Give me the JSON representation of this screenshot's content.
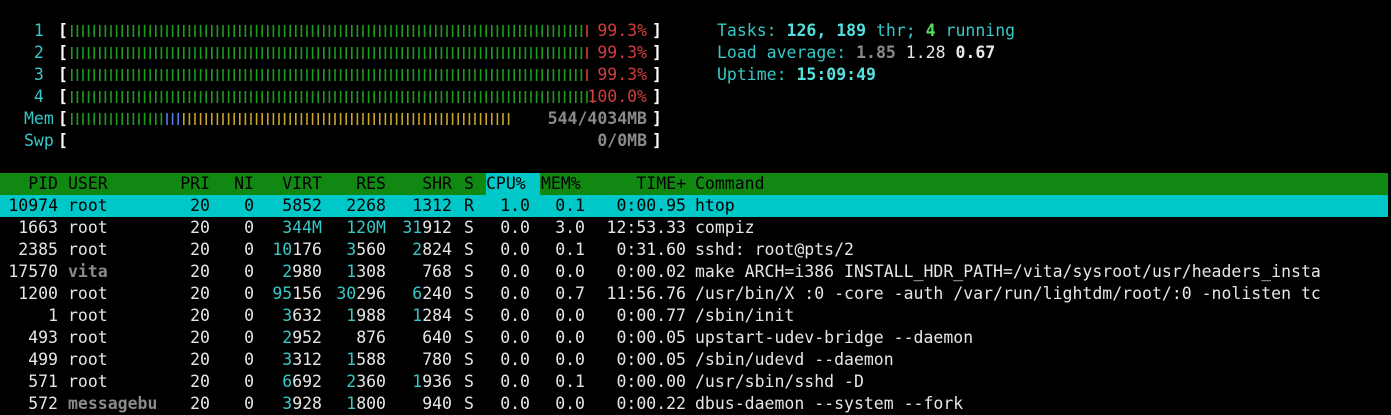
{
  "meters": {
    "cpu": [
      {
        "label": "1",
        "value_text": "99.3%",
        "percent": 99.3
      },
      {
        "label": "2",
        "value_text": "99.3%",
        "percent": 99.3
      },
      {
        "label": "3",
        "value_text": "99.3%",
        "percent": 99.3
      },
      {
        "label": "4",
        "value_text": "100.0%",
        "percent": 100.0
      }
    ],
    "mem": {
      "label": "Mem",
      "value_text": "544/4034MB",
      "used_mb": 544,
      "total_mb": 4034
    },
    "swp": {
      "label": "Swp",
      "value_text": "0/0MB",
      "used_mb": 0,
      "total_mb": 0
    }
  },
  "summary": {
    "tasks_label": "Tasks: ",
    "tasks": "126",
    "tasks_sep": ", ",
    "threads": "189",
    "thr_label": " thr; ",
    "running": "4",
    "running_label": " running",
    "load_label": "Load average: ",
    "load1": "1.85",
    "load5": "1.28",
    "load15": "0.67",
    "uptime_label": "Uptime: ",
    "uptime": "15:09:49"
  },
  "table": {
    "headers": {
      "pid": "PID",
      "user": "USER",
      "pri": "PRI",
      "ni": "NI",
      "virt": "VIRT",
      "res": "RES",
      "shr": "SHR",
      "s": "S",
      "cpu": "CPU%",
      "mem": "MEM%",
      "time": "TIME+",
      "command": "Command"
    },
    "sort_column": "CPU%",
    "rows": [
      {
        "pid": "10974",
        "user": "root",
        "pri": "20",
        "ni": "0",
        "virt": "5852",
        "res": "2268",
        "shr": "1312",
        "s": "R",
        "cpu": "1.0",
        "mem": "0.1",
        "time": "0:00.95",
        "command": "htop"
      },
      {
        "pid": "1663",
        "user": "root",
        "pri": "20",
        "ni": "0",
        "virt": "344M",
        "res": "120M",
        "shr": "31912",
        "s": "S",
        "cpu": "0.0",
        "mem": "3.0",
        "time": "12:53.33",
        "command": "compiz"
      },
      {
        "pid": "2385",
        "user": "root",
        "pri": "20",
        "ni": "0",
        "virt": "10176",
        "res": "3560",
        "shr": "2824",
        "s": "S",
        "cpu": "0.0",
        "mem": "0.1",
        "time": "0:31.60",
        "command": "sshd: root@pts/2"
      },
      {
        "pid": "17570",
        "user": "vita",
        "pri": "20",
        "ni": "0",
        "virt": "2980",
        "res": "1308",
        "shr": "768",
        "s": "S",
        "cpu": "0.0",
        "mem": "0.0",
        "time": "0:00.02",
        "command": "make ARCH=i386 INSTALL_HDR_PATH=/vita/sysroot/usr/headers_insta"
      },
      {
        "pid": "1200",
        "user": "root",
        "pri": "20",
        "ni": "0",
        "virt": "95156",
        "res": "30296",
        "shr": "6240",
        "s": "S",
        "cpu": "0.0",
        "mem": "0.7",
        "time": "11:56.76",
        "command": "/usr/bin/X :0 -core -auth /var/run/lightdm/root/:0 -nolisten tc"
      },
      {
        "pid": "1",
        "user": "root",
        "pri": "20",
        "ni": "0",
        "virt": "3632",
        "res": "1988",
        "shr": "1284",
        "s": "S",
        "cpu": "0.0",
        "mem": "0.0",
        "time": "0:00.77",
        "command": "/sbin/init"
      },
      {
        "pid": "493",
        "user": "root",
        "pri": "20",
        "ni": "0",
        "virt": "2952",
        "res": "876",
        "shr": "640",
        "s": "S",
        "cpu": "0.0",
        "mem": "0.0",
        "time": "0:00.05",
        "command": "upstart-udev-bridge --daemon"
      },
      {
        "pid": "499",
        "user": "root",
        "pri": "20",
        "ni": "0",
        "virt": "3312",
        "res": "1588",
        "shr": "780",
        "s": "S",
        "cpu": "0.0",
        "mem": "0.0",
        "time": "0:00.05",
        "command": "/sbin/udevd --daemon"
      },
      {
        "pid": "571",
        "user": "root",
        "pri": "20",
        "ni": "0",
        "virt": "6692",
        "res": "2360",
        "shr": "1936",
        "s": "S",
        "cpu": "0.0",
        "mem": "0.1",
        "time": "0:00.00",
        "command": "/usr/sbin/sshd -D"
      },
      {
        "pid": "572",
        "user": "messagebu",
        "pri": "20",
        "ni": "0",
        "virt": "3928",
        "res": "1800",
        "shr": "940",
        "s": "S",
        "cpu": "0.0",
        "mem": "0.0",
        "time": "0:00.22",
        "command": "dbus-daemon --system --fork"
      }
    ]
  },
  "colors": {
    "cpu_bar": "#1aa01a",
    "cpu_bar_kernel": "#d23c3c",
    "mem_used": "#1aa01a",
    "mem_buffers": "#5a78e6",
    "mem_cache": "#c8a428",
    "header_bg": "#118811",
    "selected_bg": "#00c8c8"
  }
}
